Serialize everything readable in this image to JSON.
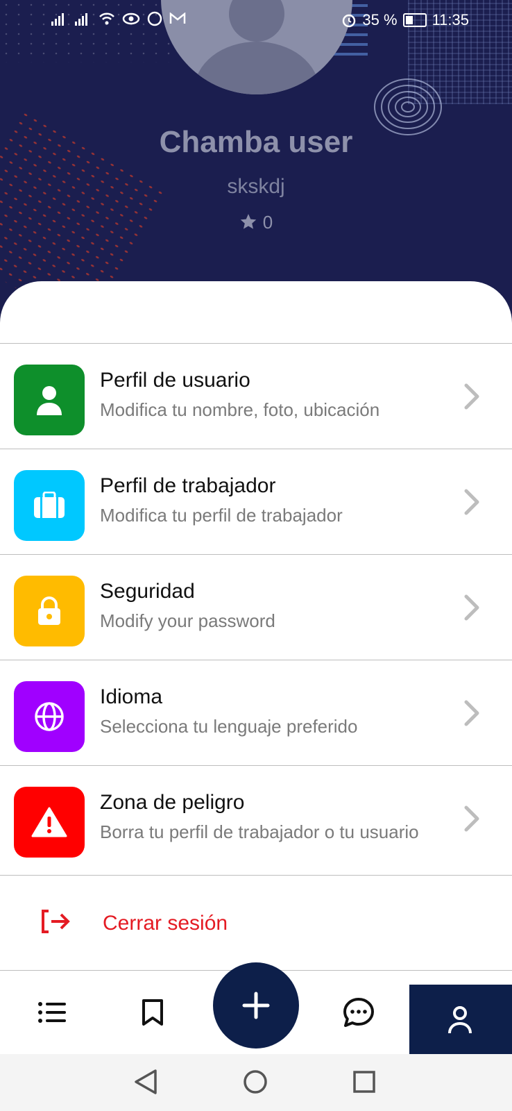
{
  "status_bar": {
    "battery": "35 %",
    "time": "11:35"
  },
  "profile": {
    "name": "Chamba user",
    "username": "skskdj",
    "rating": "0"
  },
  "menu": [
    {
      "title": "Perfil de usuario",
      "desc": "Modifica tu nombre, foto, ubicación",
      "color": "#0e8f2b",
      "icon": "user-icon"
    },
    {
      "title": "Perfil de trabajador",
      "desc": "Modifica tu perfil de trabajador",
      "color": "#00c8ff",
      "icon": "briefcase-icon"
    },
    {
      "title": "Seguridad",
      "desc": "Modify your password",
      "color": "#ffbb00",
      "icon": "lock-icon"
    },
    {
      "title": "Idioma",
      "desc": "Selecciona tu lenguaje preferido",
      "color": "#a000ff",
      "icon": "globe-icon"
    },
    {
      "title": "Zona de peligro",
      "desc": "Borra tu perfil de trabajador o tu usuario",
      "color": "#ff0000",
      "icon": "warning-icon"
    }
  ],
  "logout": {
    "label": "Cerrar sesión",
    "color": "#e41b23"
  },
  "nav": {
    "items": [
      "list-icon",
      "bookmark-icon",
      "add-icon",
      "chat-icon",
      "profile-icon"
    ],
    "active": "profile-icon",
    "accent": "#0d1f4a"
  }
}
